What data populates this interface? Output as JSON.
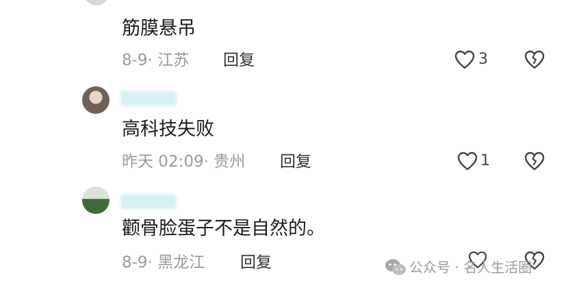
{
  "comments": [
    {
      "text": "筋膜悬吊",
      "meta": "8-9· 江苏",
      "reply_label": "回复",
      "likes": "3"
    },
    {
      "username": "",
      "text": "高科技失败",
      "meta": "昨天 02:09· 贵州",
      "reply_label": "回复",
      "likes": "1"
    },
    {
      "username": "",
      "text": "颧骨脸蛋子不是自然的。",
      "meta": "8-9· 黑龙江",
      "reply_label": "回复",
      "likes": ""
    }
  ],
  "watermark": {
    "text": "公众号 · 名人生活圈"
  }
}
